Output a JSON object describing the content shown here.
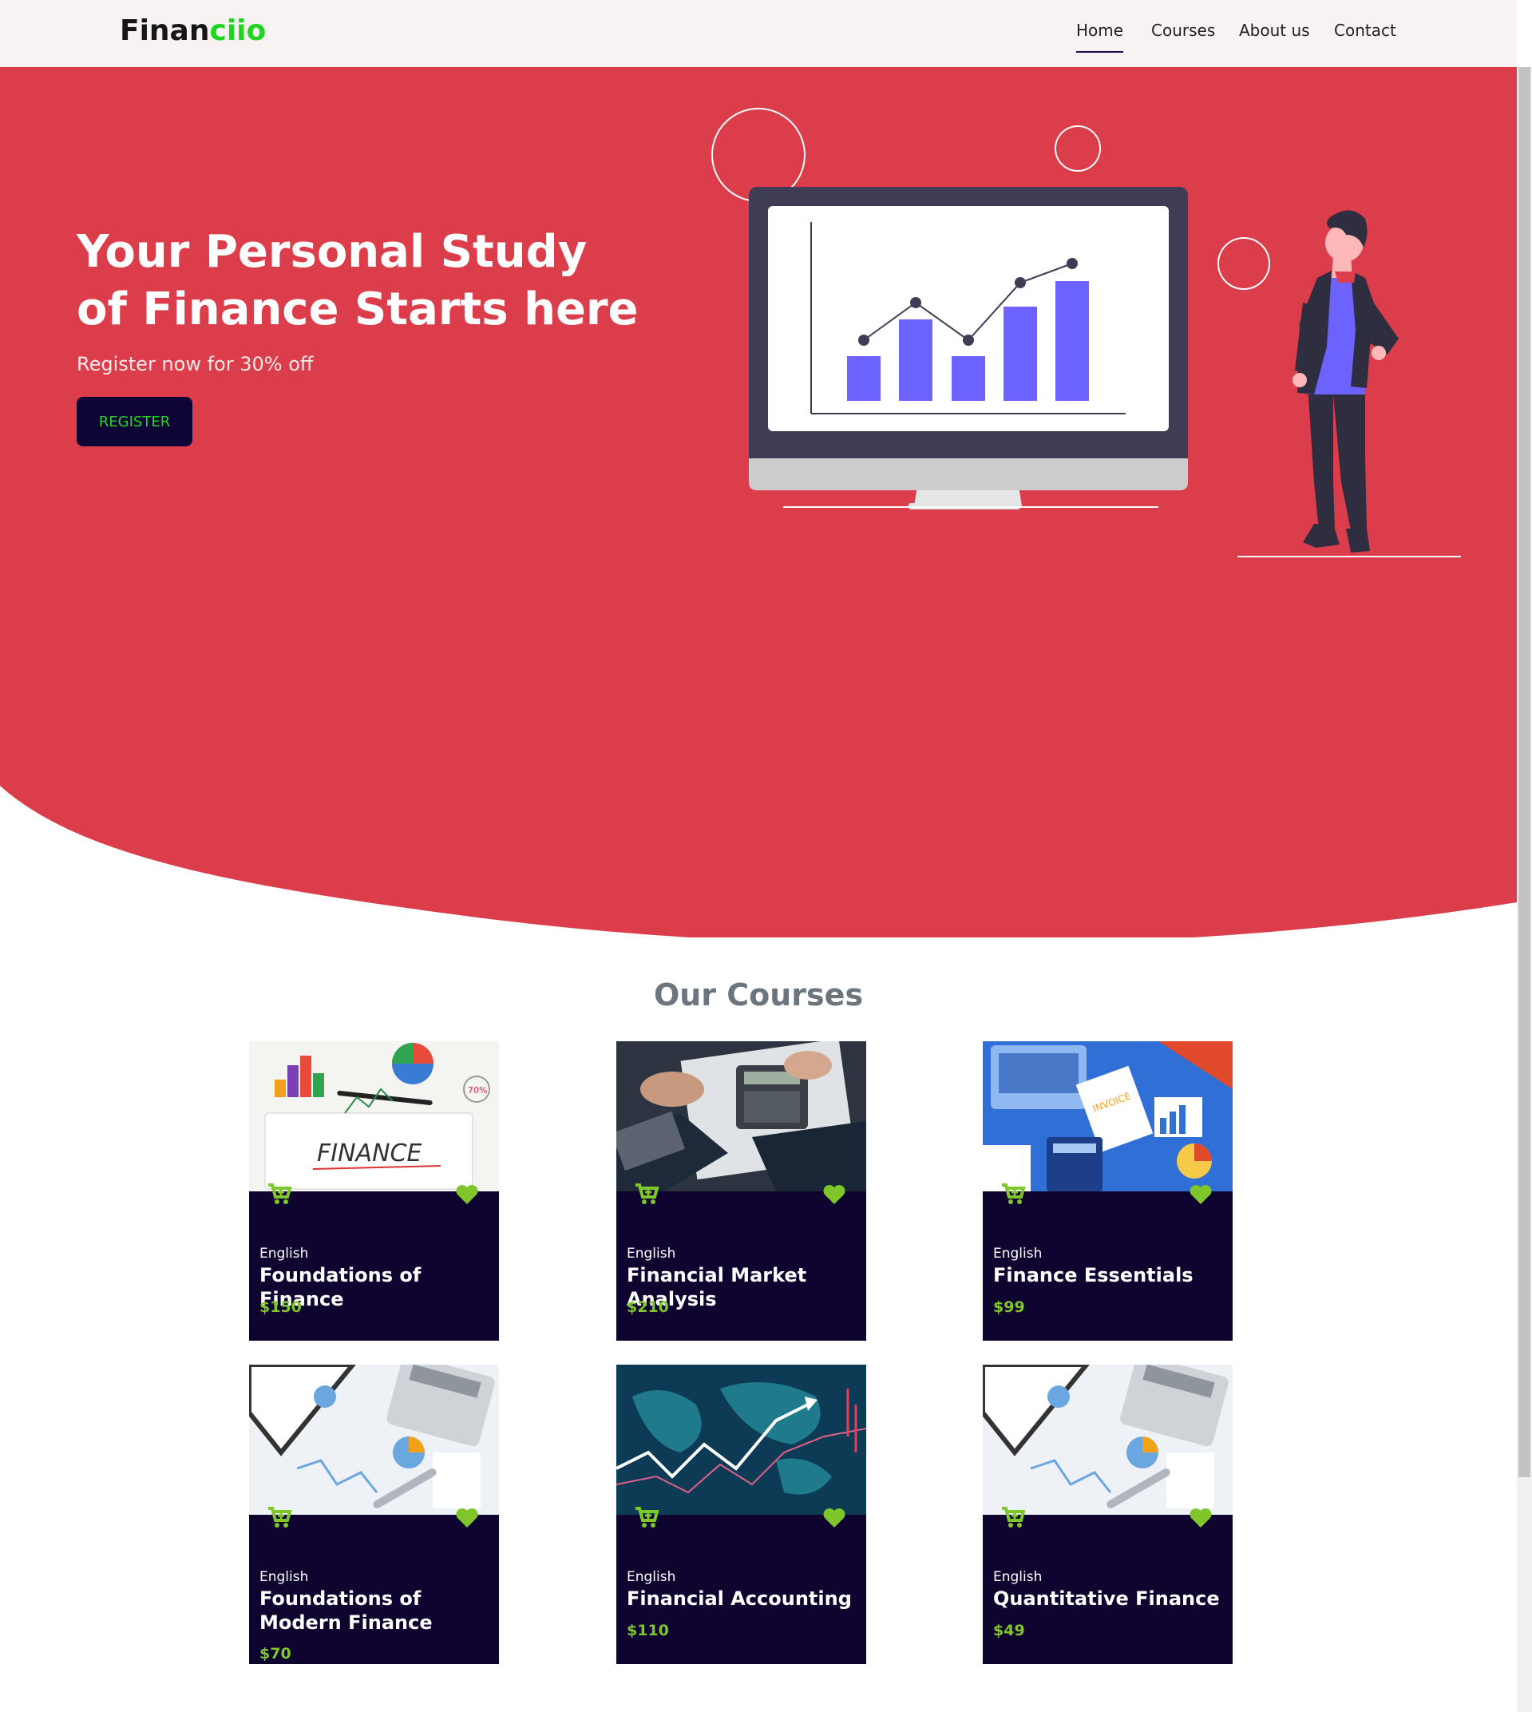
{
  "brand": {
    "name_part1": "Finan",
    "name_part2": "ciio",
    "accent_color": "#1ed61e"
  },
  "nav": {
    "items": [
      "Home",
      "Courses",
      "About us",
      "Contact"
    ],
    "active": "Home"
  },
  "hero": {
    "title": "Your Personal Study of Finance Starts here",
    "subtitle": "Register now for 30% off",
    "register_label": "REGISTER",
    "bg_color": "#dc3d4b",
    "illustration": "person-presenting-bar-chart-monitor"
  },
  "courses": {
    "title": "Our Courses",
    "items": [
      {
        "language": "English",
        "title": "Foundations of Finance",
        "price": "$150",
        "image": "finance-charts-notepad"
      },
      {
        "language": "English",
        "title": "Financial Market Analysis",
        "price": "$210",
        "image": "hands-calculator-documents"
      },
      {
        "language": "English",
        "title": "Finance Essentials",
        "price": "$99",
        "image": "flat-laptop-invoice-calculator"
      },
      {
        "language": "English",
        "title": "Foundations of Modern Finance",
        "price": "$70",
        "image": "calculator-charts-pen"
      },
      {
        "language": "English",
        "title": "Financial Accounting",
        "price": "$110",
        "image": "world-map-stock-arrow"
      },
      {
        "language": "English",
        "title": "Quantitative Finance",
        "price": "$49",
        "image": "calculator-charts-pen"
      }
    ],
    "icons": {
      "cart": "cart-plus-icon",
      "favorite": "heart-icon",
      "icon_color": "#7ec629"
    },
    "card_color": "#0f0330"
  }
}
